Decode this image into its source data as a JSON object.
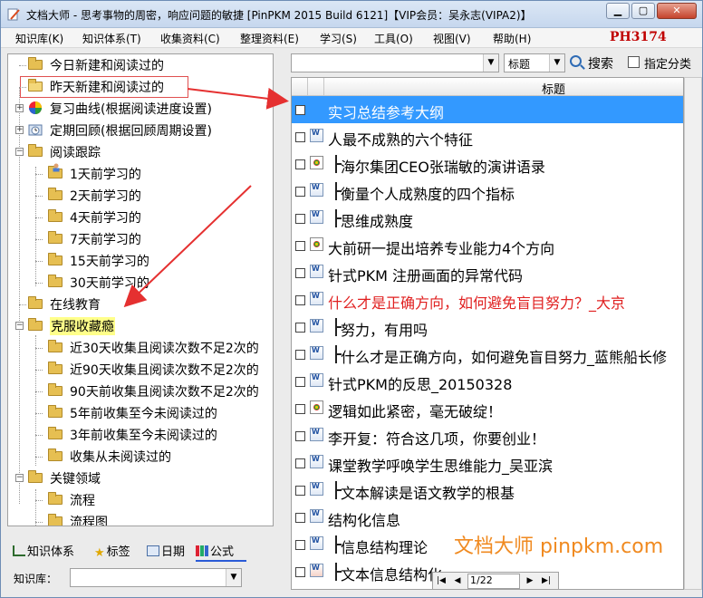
{
  "window": {
    "title": "文档大师 - 思考事物的周密，响应问题的敏捷 [PinPKM 2015 Build 6121]【VIP会员：吴永志(VIPA2)】",
    "brand_code": "PH3174"
  },
  "menu": {
    "items": [
      "知识库(K)",
      "知识体系(T)",
      "收集资料(C)",
      "整理资料(E)",
      "学习(S)",
      "工具(O)",
      "视图(V)",
      "帮助(H)"
    ]
  },
  "tree": {
    "items": [
      {
        "label": "今日新建和阅读过的",
        "icon": "folder-icon",
        "level": 1,
        "toggle": ""
      },
      {
        "label": "昨天新建和阅读过的",
        "icon": "folder-open-icon",
        "level": 1,
        "toggle": ""
      },
      {
        "label": "复习曲线(根据阅读进度设置)",
        "icon": "color-wheel-icon",
        "level": 1,
        "toggle": "+"
      },
      {
        "label": "定期回顾(根据回顾周期设置)",
        "icon": "clock-icon",
        "level": 1,
        "toggle": "+"
      },
      {
        "label": "阅读跟踪",
        "icon": "folder-icon",
        "level": 1,
        "toggle": "−"
      },
      {
        "label": "1天前学习的",
        "icon": "user-folder-icon",
        "level": 2,
        "toggle": ""
      },
      {
        "label": "2天前学习的",
        "icon": "folder-icon",
        "level": 2,
        "toggle": ""
      },
      {
        "label": "4天前学习的",
        "icon": "folder-icon",
        "level": 2,
        "toggle": ""
      },
      {
        "label": "7天前学习的",
        "icon": "folder-icon",
        "level": 2,
        "toggle": ""
      },
      {
        "label": "15天前学习的",
        "icon": "folder-icon",
        "level": 2,
        "toggle": ""
      },
      {
        "label": "30天前学习的",
        "icon": "folder-icon",
        "level": 2,
        "toggle": ""
      },
      {
        "label": "在线教育",
        "icon": "folder-icon",
        "level": 1,
        "toggle": ""
      },
      {
        "label": "克服收藏瘾",
        "icon": "folder-icon",
        "level": 1,
        "toggle": "−"
      },
      {
        "label": "近30天收集且阅读次数不足2次的",
        "icon": "folder-icon",
        "level": 2,
        "toggle": ""
      },
      {
        "label": "近90天收集且阅读次数不足2次的",
        "icon": "folder-icon",
        "level": 2,
        "toggle": ""
      },
      {
        "label": "90天前收集且阅读次数不足2次的",
        "icon": "folder-icon",
        "level": 2,
        "toggle": ""
      },
      {
        "label": "5年前收集至今未阅读过的",
        "icon": "folder-icon",
        "level": 2,
        "toggle": ""
      },
      {
        "label": "3年前收集至今未阅读过的",
        "icon": "folder-icon",
        "level": 2,
        "toggle": ""
      },
      {
        "label": "收集从未阅读过的",
        "icon": "folder-icon",
        "level": 2,
        "toggle": ""
      },
      {
        "label": "关键领域",
        "icon": "folder-icon",
        "level": 1,
        "toggle": "−"
      },
      {
        "label": "流程",
        "icon": "folder-icon",
        "level": 2,
        "toggle": ""
      },
      {
        "label": "流程图",
        "icon": "folder-icon",
        "level": 2,
        "toggle": ""
      }
    ]
  },
  "bottom_tabs": {
    "knowledge": "知识体系",
    "tags": "标签",
    "date": "日期",
    "formula": "公式"
  },
  "knowledge_base": {
    "label": "知识库：",
    "value": ""
  },
  "toolbar": {
    "search_value": "",
    "field_select": "标题",
    "search_button": "搜索",
    "specify_category": "指定分类"
  },
  "list": {
    "header_title": "标题",
    "rows": [
      {
        "text": "实习总结参考大纲",
        "icon": "none",
        "tree": false,
        "selected": true,
        "red": false
      },
      {
        "text": "人最不成熟的六个特征",
        "icon": "word-doc-icon",
        "tree": false,
        "selected": false,
        "red": false
      },
      {
        "text": "海尔集团CEO张瑞敏的演讲语录",
        "icon": "web-page-icon",
        "tree": true,
        "selected": false,
        "red": false
      },
      {
        "text": "衡量个人成熟度的四个指标",
        "icon": "word-doc-icon",
        "tree": true,
        "selected": false,
        "red": false
      },
      {
        "text": "思维成熟度",
        "icon": "word-doc-icon",
        "tree": true,
        "selected": false,
        "red": false
      },
      {
        "text": "大前研一提出培养专业能力4个方向",
        "icon": "web-page-icon",
        "tree": false,
        "selected": false,
        "red": false
      },
      {
        "text": "针式PKM 注册画面的异常代码",
        "icon": "word-doc-icon",
        "tree": false,
        "selected": false,
        "red": false
      },
      {
        "text": "什么才是正确方向，如何避免盲目努力？_大京",
        "icon": "word-doc-icon",
        "tree": false,
        "selected": false,
        "red": true
      },
      {
        "text": "努力，有用吗",
        "icon": "word-doc-icon",
        "tree": true,
        "selected": false,
        "red": false
      },
      {
        "text": "什么才是正确方向，如何避免盲目努力_蓝熊船长修",
        "icon": "word-doc-icon",
        "tree": true,
        "selected": false,
        "red": false
      },
      {
        "text": "针式PKM的反思_20150328",
        "icon": "word-doc-icon",
        "tree": false,
        "selected": false,
        "red": false
      },
      {
        "text": "逻辑如此紧密，毫无破绽！",
        "icon": "web-page-icon",
        "tree": false,
        "selected": false,
        "red": false
      },
      {
        "text": "李开复：符合这几项，你要创业！",
        "icon": "word-doc-icon",
        "tree": false,
        "selected": false,
        "red": false
      },
      {
        "text": "课堂教学呼唤学生思维能力_吴亚滨",
        "icon": "word-doc-icon",
        "tree": false,
        "selected": false,
        "red": false
      },
      {
        "text": "文本解读是语文教学的根基",
        "icon": "word-doc-icon",
        "tree": true,
        "selected": false,
        "red": false
      },
      {
        "text": "结构化信息",
        "icon": "word-doc-icon",
        "tree": false,
        "selected": false,
        "red": false
      },
      {
        "text": "信息结构理论",
        "icon": "word-doc-icon",
        "tree": true,
        "selected": false,
        "red": false
      },
      {
        "text": "文本信息结构化",
        "icon": "pdf-doc-icon",
        "tree": true,
        "selected": false,
        "red": false
      }
    ]
  },
  "pager": {
    "page": "1/22"
  },
  "watermark": "文档大师 pinpkm.com",
  "colors": {
    "selection": "#3399ff",
    "annotation_red": "#e53030",
    "brand_red": "#c00000",
    "watermark_orange": "#f08a20",
    "highlight_yellow": "#ffff8a"
  }
}
